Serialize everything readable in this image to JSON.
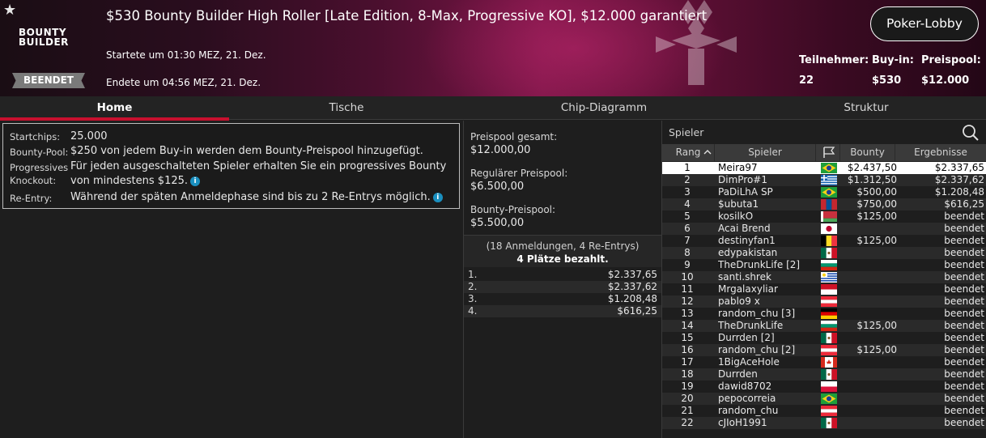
{
  "header": {
    "title": "$530 Bounty Builder High Roller [Late Edition, 8-Max, Progressive KO], $12.000 garantiert",
    "logo_line1": "BOUNTY",
    "logo_line2": "BUILDER",
    "status_badge": "BEENDET",
    "started": "Startete um 01:30 MEZ, 21. Dez.",
    "ended": "Endete um 04:56 MEZ, 21. Dez.",
    "lobby_button": "Poker-Lobby",
    "participants_label": "Teilnehmer:",
    "participants_value": "22",
    "buyin_label": "Buy-in:",
    "buyin_value": "$530",
    "prizepool_label": "Preispool:",
    "prizepool_value": "$12.000"
  },
  "tabs": [
    "Home",
    "Tische",
    "Chip-Diagramm",
    "Struktur"
  ],
  "info": {
    "startchips_label": "Startchips:",
    "startchips_value": "25.000",
    "bountypool_label": "Bounty-Pool:",
    "bountypool_value": "$250 von jedem Buy-in werden dem Bounty-Preispool hinzugefügt.",
    "progressive_label1": "Progressives",
    "progressive_label2": "Knockout:",
    "progressive_value": "Für jeden ausgeschalteten Spieler erhalten Sie ein progressives Bounty von mindestens $125.",
    "reentry_label": "Re-Entry:",
    "reentry_value": "Während der späten Anmeldephase sind bis zu 2 Re-Entrys möglich."
  },
  "prizes": {
    "total_label": "Preispool gesamt:",
    "total_value": "$12.000,00",
    "regular_label": "Regulärer Preispool:",
    "regular_value": "$6.500,00",
    "bounty_label": "Bounty-Preispool:",
    "bounty_value": "$5.500,00",
    "summary_line1": "(18 Anmeldungen, 4 Re-Entrys)",
    "summary_line2": "4 Plätze bezahlt.",
    "payouts": [
      {
        "pos": "1.",
        "amount": "$2.337,65"
      },
      {
        "pos": "2.",
        "amount": "$2.337,62"
      },
      {
        "pos": "3.",
        "amount": "$1.208,48"
      },
      {
        "pos": "4.",
        "amount": "$616,25"
      }
    ]
  },
  "players": {
    "search_placeholder": "Spieler",
    "columns": [
      "Rang",
      "Spieler",
      "Bounty",
      "Ergebnisse"
    ],
    "rows": [
      {
        "rank": "1",
        "name": "Meira97",
        "flag": "brazil",
        "bounty": "$2.437,50",
        "result": "$2.337,65"
      },
      {
        "rank": "2",
        "name": "DimPro#1",
        "flag": "greece",
        "bounty": "$1.312,50",
        "result": "$2.337,62"
      },
      {
        "rank": "3",
        "name": "PaDiLhA SP",
        "flag": "brazil",
        "bounty": "$500,00",
        "result": "$1.208,48"
      },
      {
        "rank": "4",
        "name": "$ubuta1",
        "flag": "mongolia",
        "bounty": "$750,00",
        "result": "$616,25"
      },
      {
        "rank": "5",
        "name": "kosilkO",
        "flag": "belarus",
        "bounty": "$125,00",
        "result": "beendet"
      },
      {
        "rank": "6",
        "name": "Acai Brend",
        "flag": "japan",
        "bounty": "",
        "result": "beendet"
      },
      {
        "rank": "7",
        "name": "destinyfan1",
        "flag": "belgium",
        "bounty": "$125,00",
        "result": "beendet"
      },
      {
        "rank": "8",
        "name": "edypakistan",
        "flag": "mexico",
        "bounty": "",
        "result": "beendet"
      },
      {
        "rank": "9",
        "name": "TheDrunkLife [2]",
        "flag": "bulgaria",
        "bounty": "",
        "result": "beendet"
      },
      {
        "rank": "10",
        "name": "santi.shrek",
        "flag": "uruguay",
        "bounty": "",
        "result": "beendet"
      },
      {
        "rank": "11",
        "name": "Mrgalaxyliar",
        "flag": "indonesia",
        "bounty": "",
        "result": "beendet"
      },
      {
        "rank": "12",
        "name": "pablo9 x",
        "flag": "austria",
        "bounty": "",
        "result": "beendet"
      },
      {
        "rank": "13",
        "name": "random_chu [3]",
        "flag": "germany",
        "bounty": "",
        "result": "beendet"
      },
      {
        "rank": "14",
        "name": "TheDrunkLife",
        "flag": "bulgaria",
        "bounty": "$125,00",
        "result": "beendet"
      },
      {
        "rank": "15",
        "name": "Durrden [2]",
        "flag": "mexico",
        "bounty": "",
        "result": "beendet"
      },
      {
        "rank": "16",
        "name": "random_chu [2]",
        "flag": "austria",
        "bounty": "$125,00",
        "result": "beendet"
      },
      {
        "rank": "17",
        "name": "1BigAceHole",
        "flag": "canada",
        "bounty": "",
        "result": "beendet"
      },
      {
        "rank": "18",
        "name": "Durrden",
        "flag": "mexico",
        "bounty": "",
        "result": "beendet"
      },
      {
        "rank": "19",
        "name": "dawid8702",
        "flag": "poland",
        "bounty": "",
        "result": "beendet"
      },
      {
        "rank": "20",
        "name": "pepocorreia",
        "flag": "brazil",
        "bounty": "",
        "result": "beendet"
      },
      {
        "rank": "21",
        "name": "random_chu",
        "flag": "austria",
        "bounty": "",
        "result": "beendet"
      },
      {
        "rank": "22",
        "name": "cJIoH1991",
        "flag": "mexico",
        "bounty": "",
        "result": "beendet"
      }
    ]
  },
  "colors": {
    "accent": "#c8102e",
    "info_icon": "#1a8fbf"
  }
}
